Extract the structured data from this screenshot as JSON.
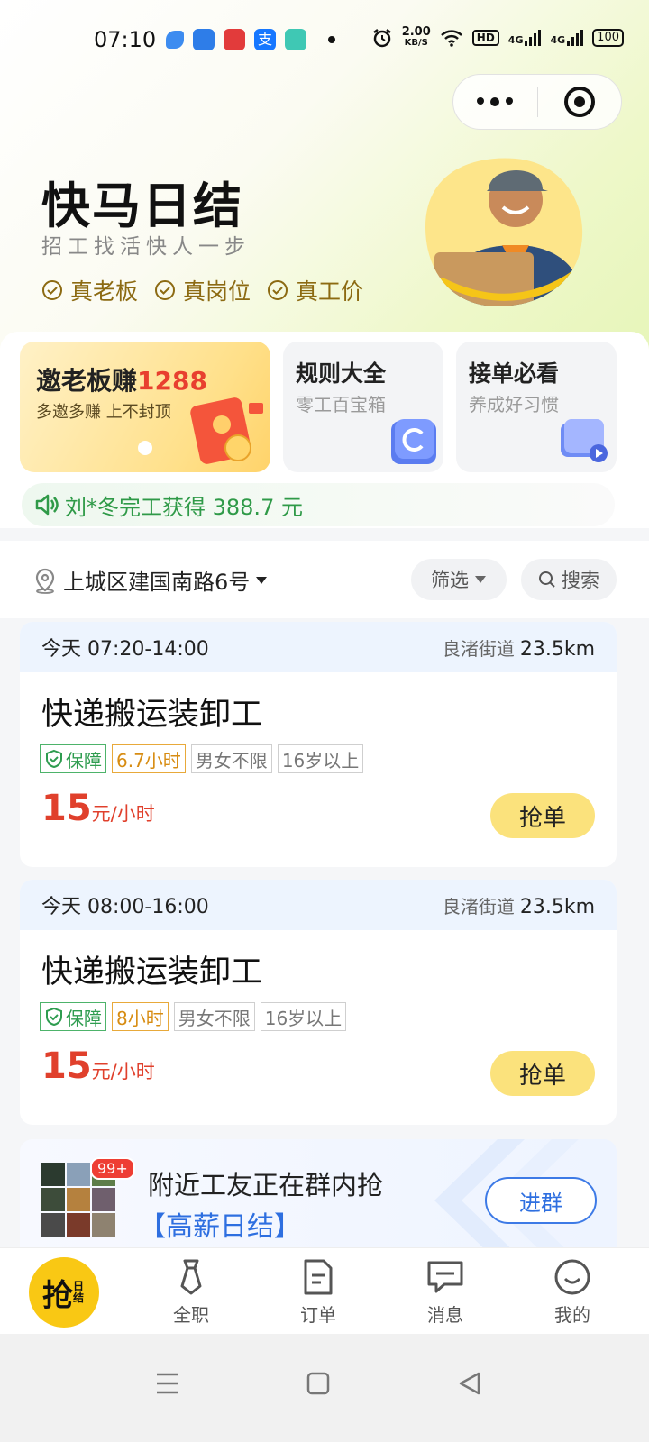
{
  "status_bar": {
    "time": "07:10",
    "speed_value": "2.00",
    "speed_unit": "KB/S",
    "hd": "HD",
    "signal1": "4G",
    "signal2": "4G",
    "battery": "100"
  },
  "hero": {
    "title": "快马日结",
    "slogan": "招工找活快人一步",
    "badges": [
      "真老板",
      "真岗位",
      "真工价"
    ]
  },
  "cards": {
    "promo_title_prefix": "邀老板赚",
    "promo_amount": "1288",
    "promo_sub": "多邀多赚 上不封顶",
    "rules_title": "规则大全",
    "rules_sub": "零工百宝箱",
    "guide_title": "接单必看",
    "guide_sub": "养成好习惯"
  },
  "marquee": {
    "text": "刘*冬完工获得 388.7 元"
  },
  "filter": {
    "location": "上城区建国南路6号",
    "filter_label": "筛选",
    "search_label": "搜索"
  },
  "jobs": [
    {
      "time": "今天 07:20-14:00",
      "street": "良渚街道",
      "distance": "23.5km",
      "title": "快递搬运装卸工",
      "tags": [
        "保障",
        "6.7小时",
        "男女不限",
        "16岁以上"
      ],
      "price": "15",
      "unit": "元/小时",
      "button": "抢单"
    },
    {
      "time": "今天 08:00-16:00",
      "street": "良渚街道",
      "distance": "23.5km",
      "title": "快递搬运装卸工",
      "tags": [
        "保障",
        "8小时",
        "男女不限",
        "16岁以上"
      ],
      "price": "15",
      "unit": "元/小时",
      "button": "抢单"
    }
  ],
  "group": {
    "badge": "99+",
    "line1": "附近工友正在群内抢",
    "line2": "【高薪日结】",
    "button": "进群"
  },
  "tabbar": {
    "main_char": "抢",
    "main_small": "日结",
    "items": [
      "全职",
      "订单",
      "消息",
      "我的"
    ]
  },
  "colors": {
    "accent_yellow": "#f9c814",
    "price_red": "#e0402c",
    "marquee_green": "#2f9a48",
    "link_blue": "#2e6fe0"
  }
}
